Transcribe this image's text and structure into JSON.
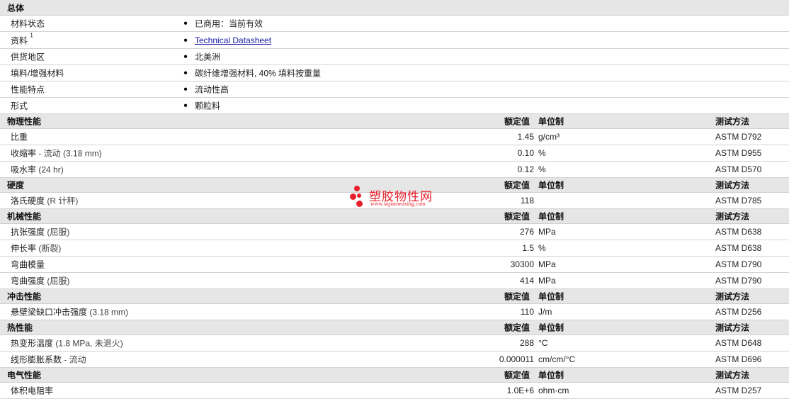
{
  "watermark": {
    "title": "塑胶物性网",
    "url": "www.sujiaowuxing.com"
  },
  "general": {
    "title": "总体",
    "rows": [
      {
        "label": "材料状态",
        "sup": "",
        "value": "已商用：当前有效",
        "link": false
      },
      {
        "label": "资料",
        "sup": "1",
        "value": "Technical Datasheet",
        "link": true
      },
      {
        "label": "供货地区",
        "sup": "",
        "value": "北美洲",
        "link": false
      },
      {
        "label": "填料/增强材料",
        "sup": "",
        "value": "碳纤维增强材料, 40% 填料按重量",
        "link": false
      },
      {
        "label": "性能特点",
        "sup": "",
        "value": "流动性高",
        "link": false
      },
      {
        "label": "形式",
        "sup": "",
        "value": "颗粒料",
        "link": false
      }
    ]
  },
  "headers": {
    "nominal": "额定值",
    "unit": "单位制",
    "method": "测试方法"
  },
  "sections": [
    {
      "title": "物理性能",
      "rows": [
        {
          "label": "比重",
          "cond": "",
          "value": "1.45",
          "unit": "g/cm³",
          "method": "ASTM D792"
        },
        {
          "label": "收缩率",
          "cond": " - 流动 (3.18 mm)",
          "value": "0.10",
          "unit": "%",
          "method": "ASTM D955"
        },
        {
          "label": "吸水率",
          "cond": " (24 hr)",
          "value": "0.12",
          "unit": "%",
          "method": "ASTM D570"
        }
      ]
    },
    {
      "title": "硬度",
      "rows": [
        {
          "label": "洛氏硬度",
          "cond": " (R 计秤)",
          "value": "118",
          "unit": "",
          "method": "ASTM D785"
        }
      ]
    },
    {
      "title": "机械性能",
      "rows": [
        {
          "label": "抗张强度",
          "cond": " (屈服)",
          "value": "276",
          "unit": "MPa",
          "method": "ASTM D638"
        },
        {
          "label": "伸长率",
          "cond": " (断裂)",
          "value": "1.5",
          "unit": "%",
          "method": "ASTM D638"
        },
        {
          "label": "弯曲模量",
          "cond": "",
          "value": "30300",
          "unit": "MPa",
          "method": "ASTM D790"
        },
        {
          "label": "弯曲强度",
          "cond": " (屈服)",
          "value": "414",
          "unit": "MPa",
          "method": "ASTM D790"
        }
      ]
    },
    {
      "title": "冲击性能",
      "rows": [
        {
          "label": "悬壁梁缺口冲击强度",
          "cond": " (3.18 mm)",
          "value": "110",
          "unit": "J/m",
          "method": "ASTM D256"
        }
      ]
    },
    {
      "title": "热性能",
      "rows": [
        {
          "label": "热变形温度",
          "cond": " (1.8 MPa, 未退火)",
          "value": "288",
          "unit": "°C",
          "method": "ASTM D648"
        },
        {
          "label": "线形膨胀系数",
          "cond": " - 流动",
          "value": "0.000011",
          "unit": "cm/cm/°C",
          "method": "ASTM D696"
        }
      ]
    },
    {
      "title": "电气性能",
      "rows": [
        {
          "label": "体积电阻率",
          "cond": "",
          "value": "1.0E+6",
          "unit": "ohm·cm",
          "method": "ASTM D257"
        }
      ]
    }
  ]
}
